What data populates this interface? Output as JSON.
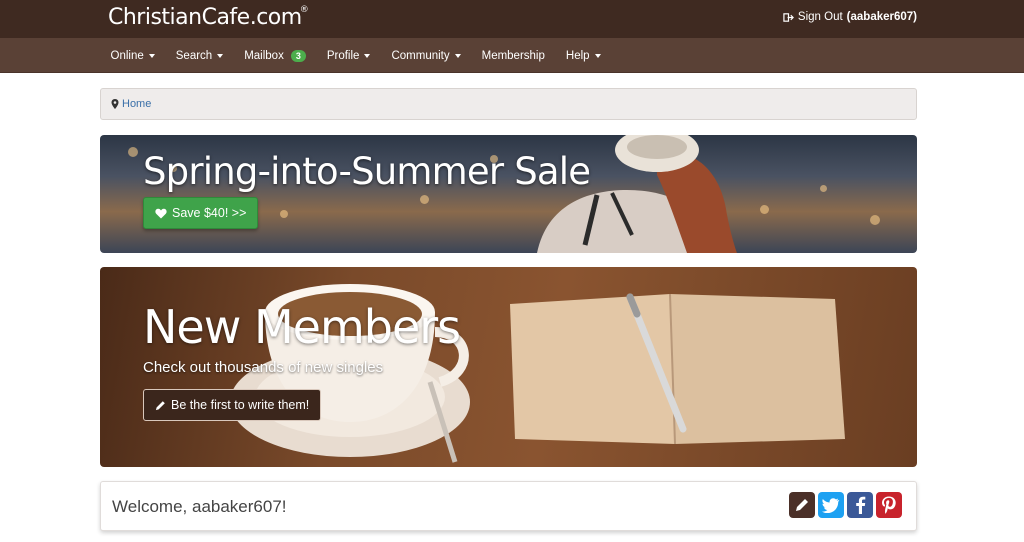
{
  "header": {
    "logo": "ChristianCafe.com",
    "logo_mark": "®",
    "signout_label": "Sign Out",
    "username_display": "(aabaker607)",
    "icons": {
      "signout": "sign-out-icon"
    }
  },
  "nav": {
    "items": [
      {
        "label": "Online",
        "dropdown": true
      },
      {
        "label": "Search",
        "dropdown": true
      },
      {
        "label": "Mailbox",
        "dropdown": false,
        "badge": "3"
      },
      {
        "label": "Profile",
        "dropdown": true
      },
      {
        "label": "Community",
        "dropdown": true
      },
      {
        "label": "Membership",
        "dropdown": false
      },
      {
        "label": "Help",
        "dropdown": true
      }
    ]
  },
  "breadcrumb": {
    "home": "Home",
    "icon": "map-marker-icon"
  },
  "promo_sale": {
    "title": "Spring-into-Summer Sale",
    "button": "Save $40! >>",
    "icon": "heart-icon"
  },
  "promo_new_members": {
    "title": "New Members",
    "subtitle": "Check out thousands of new singles",
    "button": "Be the first to write them!",
    "icon": "pencil-icon"
  },
  "welcome": {
    "text": "Welcome, aabaker607!",
    "social": [
      "edit-icon",
      "twitter-icon",
      "facebook-icon",
      "pinterest-icon"
    ]
  },
  "colors": {
    "header_bg": "#3f2a21",
    "nav_bg": "#5a4136",
    "badge": "#4cae4c",
    "sale_button": "#3fa34a",
    "link": "#3a6fa8"
  }
}
